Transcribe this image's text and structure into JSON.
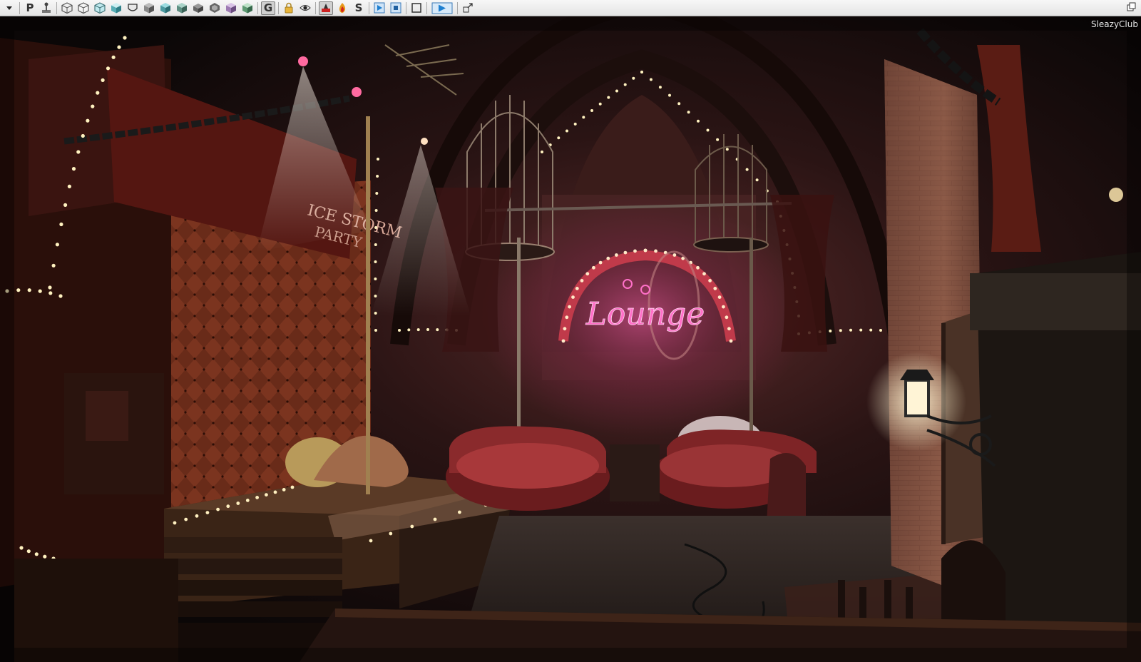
{
  "viewport": {
    "level_name": "SleazyClub"
  },
  "scene": {
    "neon_sign_text": "Lounge",
    "banner_line1": "ICE STORM",
    "banner_line2": "PARTY"
  },
  "toolbar": {
    "buttons": [
      {
        "name": "dropdown-menu-button",
        "icon": "chevron-down-icon"
      },
      {
        "name": "p-mode-button",
        "glyph": "P"
      },
      {
        "name": "joystick-button",
        "icon": "joystick-icon"
      },
      {
        "name": "box-wire-button",
        "icon": "wireframe-cube-icon"
      },
      {
        "name": "box-outline-button",
        "icon": "outline-cube-icon"
      },
      {
        "name": "box-unlit-button",
        "icon": "unlit-cube-icon"
      },
      {
        "name": "box-lit-button",
        "icon": "lit-cube-icon",
        "pressed": true
      },
      {
        "name": "shader-complexity-button",
        "icon": "shader-cube-icon"
      },
      {
        "name": "lighting-only-button",
        "icon": "lighting-cube-icon"
      },
      {
        "name": "light-complexity-button",
        "icon": "light-complexity-icon"
      },
      {
        "name": "texture-density-button",
        "icon": "texture-density-icon"
      },
      {
        "name": "lightmap-density-button",
        "icon": "lightmap-density-icon"
      },
      {
        "name": "reflections-button",
        "icon": "reflection-cube-icon"
      },
      {
        "name": "vertex-color-button",
        "icon": "vertex-color-icon"
      },
      {
        "name": "lod-coloration-button",
        "icon": "lod-cube-icon"
      },
      {
        "name": "game-view-button",
        "glyph": "G",
        "pressed": true
      },
      {
        "name": "lock-viewport-button",
        "icon": "lock-icon"
      },
      {
        "name": "realtime-preview-button",
        "icon": "eye-icon"
      },
      {
        "name": "streaming-volumes-button",
        "icon": "streaming-icon",
        "pressed": true
      },
      {
        "name": "fire-preview-button",
        "icon": "fire-icon"
      },
      {
        "name": "s-mode-button",
        "glyph": "S"
      },
      {
        "name": "play-in-viewport-button",
        "icon": "play-small-icon"
      },
      {
        "name": "stop-in-viewport-button",
        "icon": "stop-icon"
      },
      {
        "name": "maximize-view-button",
        "icon": "square-icon"
      },
      {
        "name": "play-in-editor-button",
        "icon": "play-icon"
      },
      {
        "name": "viewport-options-button",
        "icon": "viewport-options-icon"
      }
    ],
    "colors": {
      "background": "#eeeeee",
      "accent_blue": "#1e7fd0",
      "accent_red": "#d02020"
    }
  }
}
